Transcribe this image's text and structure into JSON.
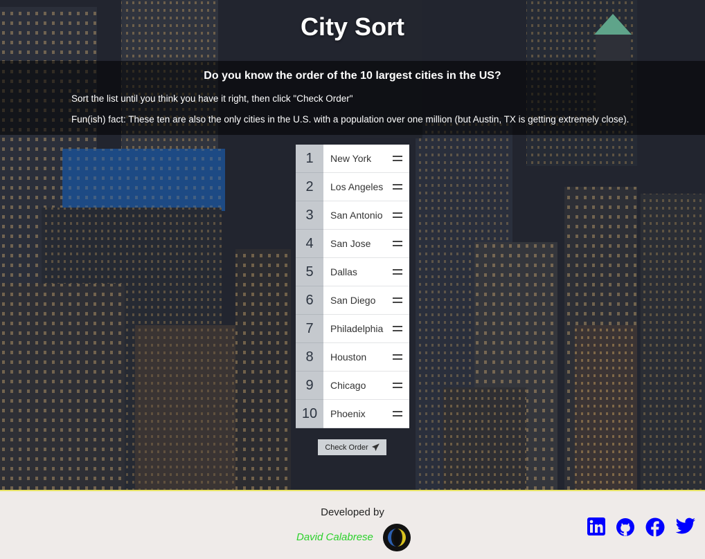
{
  "header": {
    "title": "City Sort"
  },
  "intro": {
    "question": "Do you know the order of the 10 largest cities in the US?",
    "instruction": "Sort the list until you think you have it right, then click \"Check Order\"",
    "fact": "Fun(ish) fact: These ten are also the only cities in the U.S. with a population over one million (but Austin, TX is getting extremely close)."
  },
  "list": {
    "items": [
      {
        "rank": "1",
        "city": "New York"
      },
      {
        "rank": "2",
        "city": "Los Angeles"
      },
      {
        "rank": "3",
        "city": "San Antonio"
      },
      {
        "rank": "4",
        "city": "San Jose"
      },
      {
        "rank": "5",
        "city": "Dallas"
      },
      {
        "rank": "6",
        "city": "San Diego"
      },
      {
        "rank": "7",
        "city": "Philadelphia"
      },
      {
        "rank": "8",
        "city": "Houston"
      },
      {
        "rank": "9",
        "city": "Chicago"
      },
      {
        "rank": "10",
        "city": "Phoenix"
      }
    ],
    "check_button_label": "Check Order",
    "check_button_icon": "paper-plane-icon"
  },
  "footer": {
    "developed_by": "Developed by",
    "developer_name": "David Calabrese",
    "social": [
      {
        "name": "linkedin",
        "icon": "linkedin-icon"
      },
      {
        "name": "github",
        "icon": "github-icon"
      },
      {
        "name": "facebook",
        "icon": "facebook-icon"
      },
      {
        "name": "twitter",
        "icon": "twitter-icon"
      }
    ]
  },
  "colors": {
    "footer_bg": "#efebe9",
    "footer_border": "#e8e468",
    "developer_name": "#2cd12c",
    "social_icons": "#0000ff",
    "rank_bg": "#c5c9ce"
  }
}
